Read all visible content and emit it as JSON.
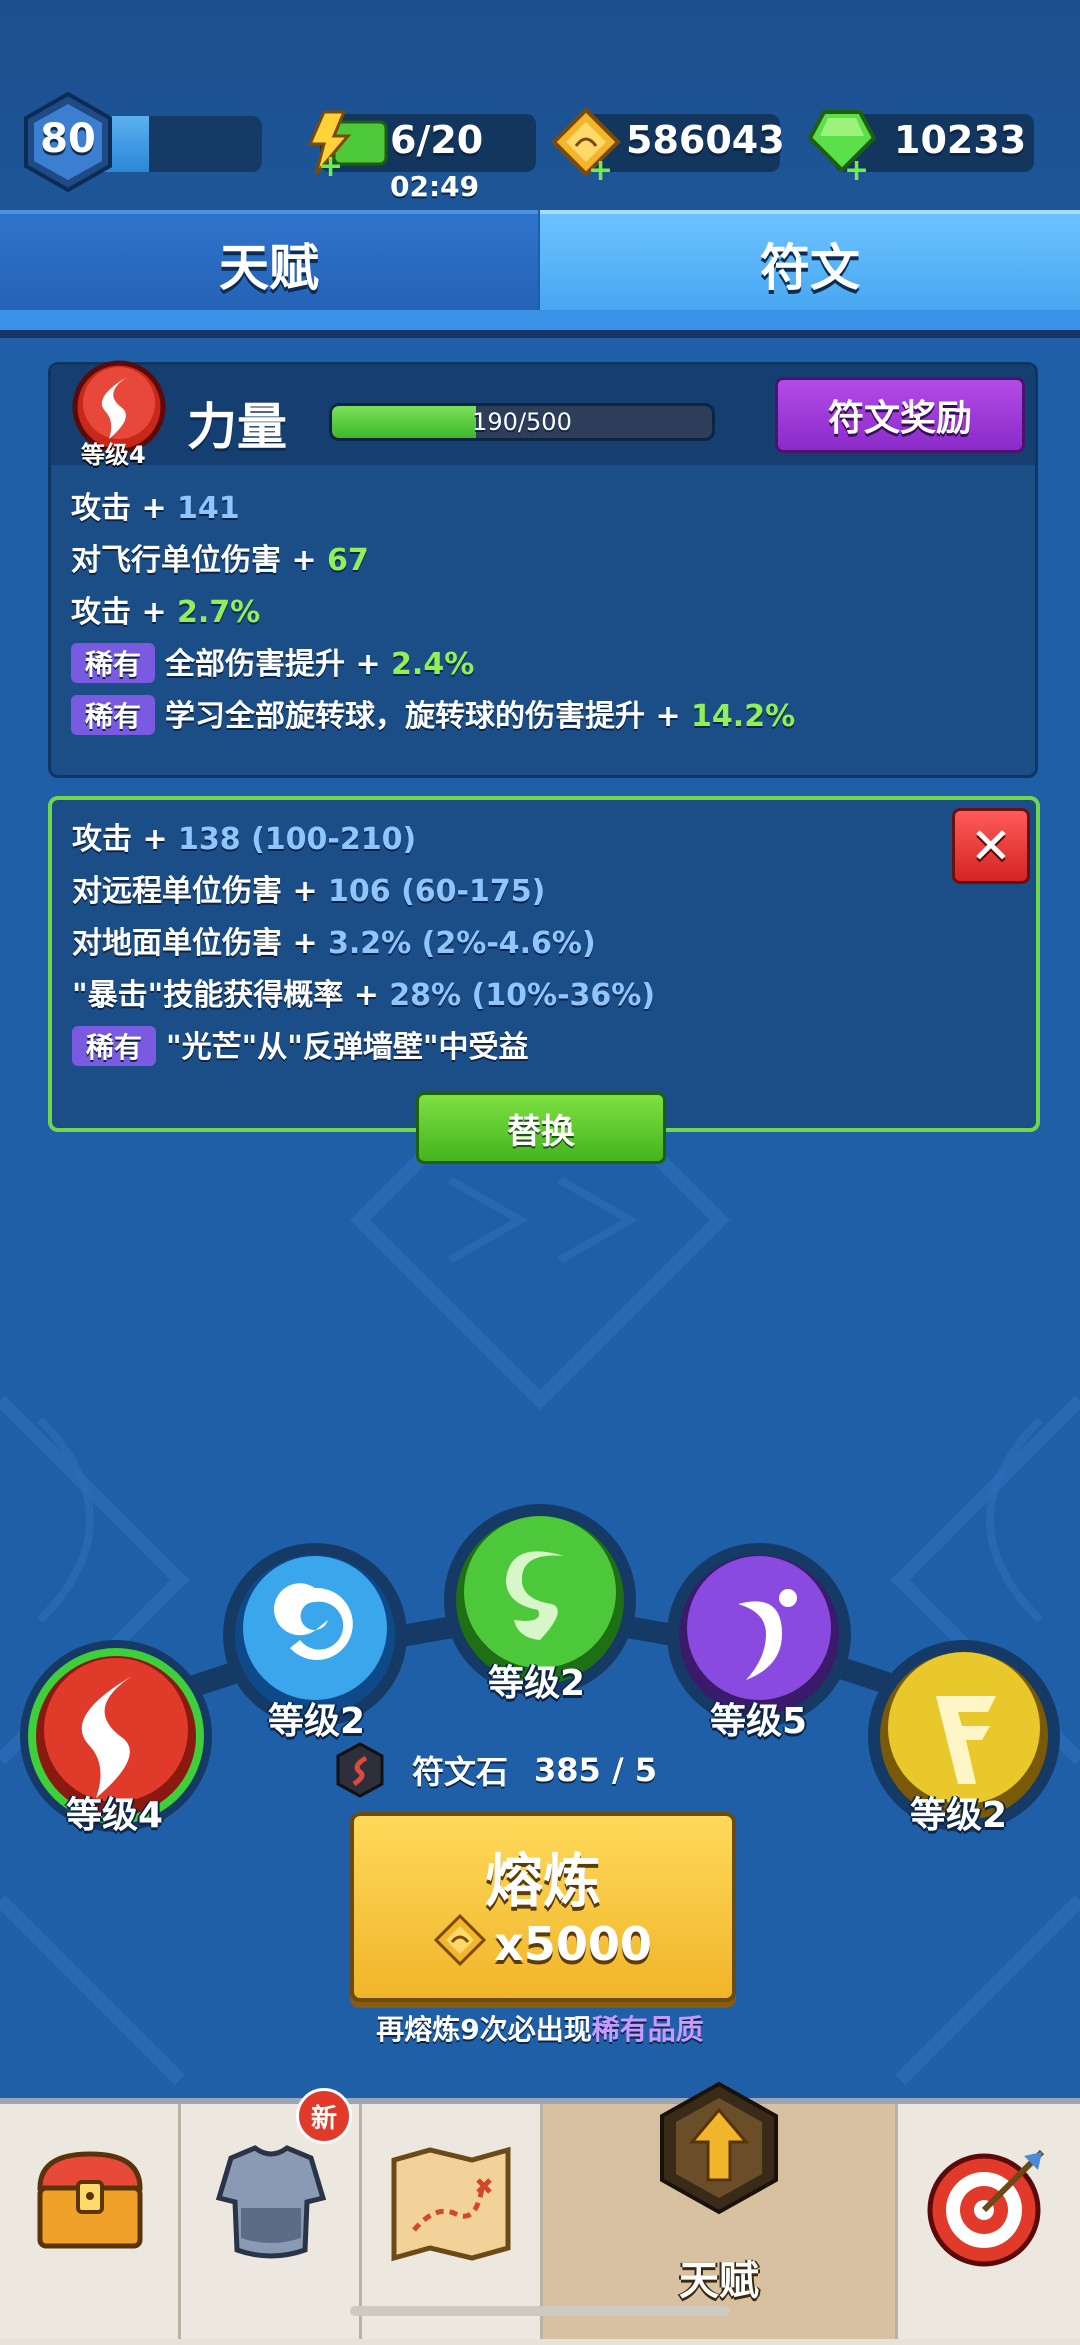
{
  "header": {
    "player_level": "80",
    "xp_fraction": 0.3,
    "energy": "6/20",
    "energy_timer": "02:49",
    "gold": "586043",
    "gems": "10233",
    "icons": {
      "energy": "lightning-icon",
      "gold": "gold-coin-icon",
      "gems": "gem-icon"
    }
  },
  "tabs": [
    {
      "label": "天赋",
      "active": false
    },
    {
      "label": "符文",
      "active": true
    }
  ],
  "current_rune": {
    "level_label": "等级4",
    "name": "力量",
    "progress_text": "190/500",
    "progress_fraction": 0.38,
    "reward_button": "符文奖励",
    "stats": [
      {
        "label": "攻击 + ",
        "value": "141",
        "color": "blue"
      },
      {
        "label": "对飞行单位伤害 + ",
        "value": "67",
        "color": "green"
      },
      {
        "label": "攻击 + ",
        "value": "2.7%",
        "color": "green"
      },
      {
        "tag": "稀有",
        "label": "全部伤害提升 + ",
        "value": "2.4%",
        "color": "green"
      },
      {
        "tag": "稀有",
        "label": "学习全部旋转球，旋转球的伤害提升 + ",
        "value": "14.2%",
        "color": "green"
      }
    ]
  },
  "new_roll": {
    "stats": [
      {
        "label": "攻击 + ",
        "value": "138 (100-210)"
      },
      {
        "label": "对远程单位伤害 + ",
        "value": "106 (60-175)"
      },
      {
        "label": "对地面单位伤害 + ",
        "value": "3.2% (2%-4.6%)"
      },
      {
        "label": "\"暴击\"技能获得概率 + ",
        "value": "28% (10%-36%)"
      },
      {
        "tag": "稀有",
        "label": "\"光芒\"从\"反弹墙壁\"中受益",
        "value": ""
      }
    ],
    "close_symbol": "✕",
    "replace_button": "替换"
  },
  "runes": [
    {
      "name": "power",
      "level": "等级4",
      "color": "#e03a2a"
    },
    {
      "name": "water",
      "level": "等级2",
      "color": "#3aa6ec"
    },
    {
      "name": "nature",
      "level": "等级2",
      "color": "#4cc83a"
    },
    {
      "name": "shadow",
      "level": "等级5",
      "color": "#8a4ae0"
    },
    {
      "name": "wind",
      "level": "等级2",
      "color": "#e8c82a"
    }
  ],
  "runestone": {
    "label": "符文石",
    "count": "385 / 5"
  },
  "smelt": {
    "title": "熔炼",
    "cost": "x5000"
  },
  "hint": {
    "prefix": "再熔炼9次必出现",
    "rare": "稀有品质"
  },
  "nav": {
    "items": [
      {
        "name": "chest"
      },
      {
        "name": "equipment",
        "badge": "新"
      },
      {
        "name": "map"
      },
      {
        "name": "talent",
        "label": "天赋",
        "active": true
      },
      {
        "name": "target"
      }
    ]
  }
}
